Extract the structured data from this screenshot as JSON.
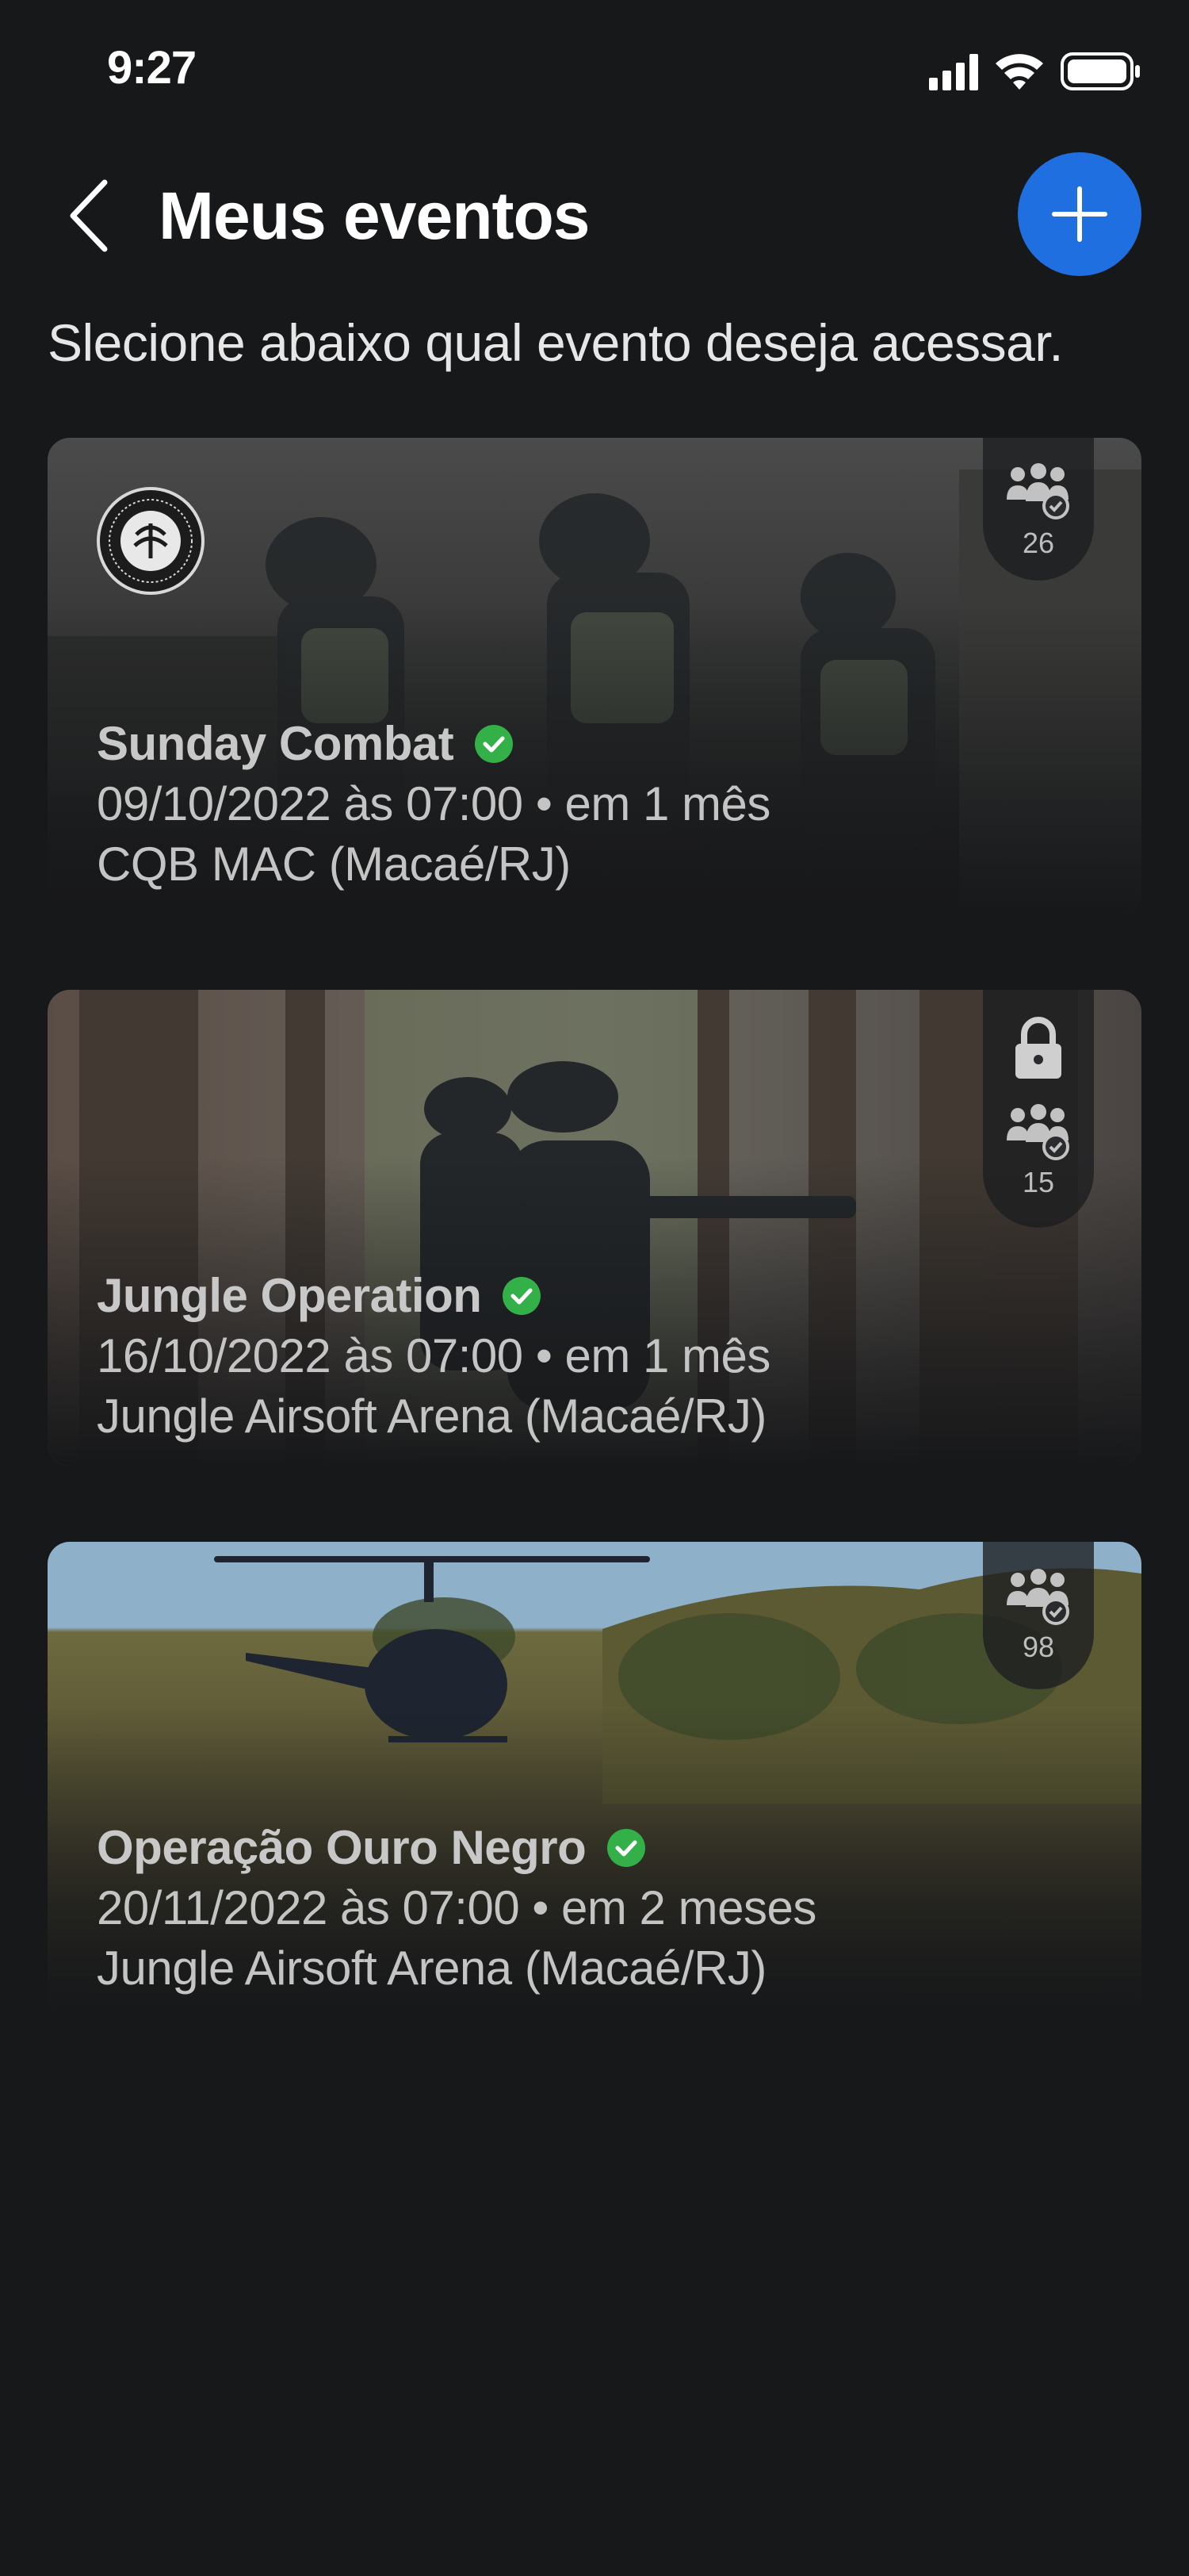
{
  "status_bar": {
    "time": "9:27"
  },
  "header": {
    "title": "Meus eventos"
  },
  "subtitle": "Slecione abaixo qual evento deseja acessar.",
  "events": [
    {
      "title": "Sunday Combat",
      "date": "09/10/2022 às 07:00 • em 1 mês",
      "location": "CQB MAC (Macaé/RJ)",
      "participants": "26",
      "locked": false,
      "verified": true
    },
    {
      "title": "Jungle Operation",
      "date": "16/10/2022 às 07:00 • em 1 mês",
      "location": "Jungle Airsoft Arena (Macaé/RJ)",
      "participants": "15",
      "locked": true,
      "verified": true
    },
    {
      "title": "Operação Ouro Negro",
      "date": "20/11/2022 às 07:00 • em 2 meses",
      "location": "Jungle Airsoft Arena (Macaé/RJ)",
      "participants": "98",
      "locked": false,
      "verified": true
    }
  ],
  "icons": {
    "back": "chevron-left-icon",
    "add": "plus-icon",
    "verified": "check-circle-icon",
    "participants": "group-check-icon",
    "lock": "lock-icon"
  },
  "colors": {
    "background": "#17181a",
    "accent": "#1f6fe0",
    "verified": "#34b049"
  }
}
